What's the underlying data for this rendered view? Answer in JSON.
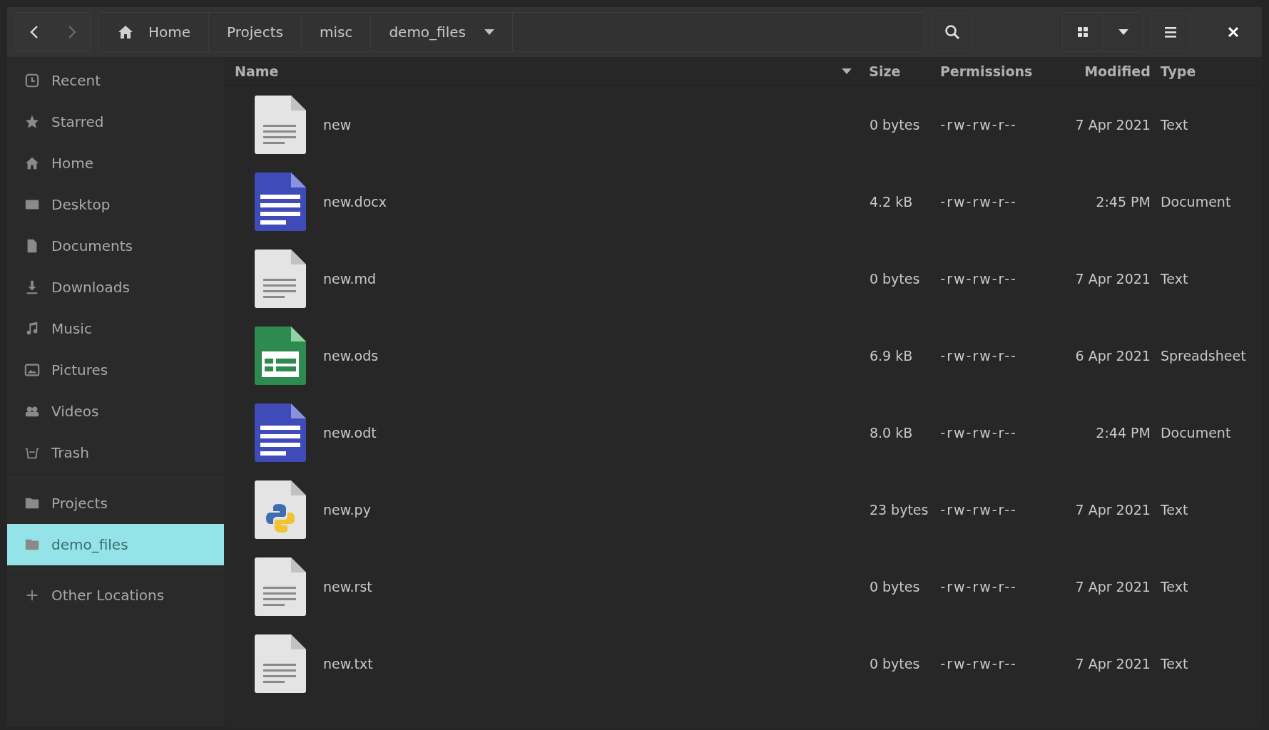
{
  "toolbar": {
    "nav": [
      {
        "kind": "back",
        "disabled": false
      },
      {
        "kind": "forward",
        "disabled": true
      }
    ],
    "breadcrumbs": [
      {
        "label": "Home"
      },
      {
        "label": "Projects"
      },
      {
        "label": "misc"
      },
      {
        "label": "demo_files"
      }
    ]
  },
  "sidebar": {
    "items": [
      {
        "label": "Recent",
        "kind": "recent",
        "selected": false
      },
      {
        "label": "Starred",
        "kind": "star",
        "selected": false
      },
      {
        "label": "Home",
        "kind": "home",
        "selected": false
      },
      {
        "label": "Desktop",
        "kind": "desktop",
        "selected": false
      },
      {
        "label": "Documents",
        "kind": "document",
        "selected": false
      },
      {
        "label": "Downloads",
        "kind": "download",
        "selected": false
      },
      {
        "label": "Music",
        "kind": "music",
        "selected": false
      },
      {
        "label": "Pictures",
        "kind": "pictures",
        "selected": false
      },
      {
        "label": "Videos",
        "kind": "videos",
        "selected": false
      },
      {
        "label": "Trash",
        "kind": "trash",
        "selected": false
      }
    ],
    "bookmarks": [
      {
        "label": "Projects",
        "kind": "folder",
        "selected": false
      },
      {
        "label": "demo_files",
        "kind": "folder",
        "selected": true
      }
    ],
    "other": {
      "label": "Other Locations",
      "kind": "plus"
    }
  },
  "table": {
    "columns": [
      {
        "label": "Name",
        "sorted": true
      },
      {
        "label": "Size",
        "sorted": false
      },
      {
        "label": "Permissions",
        "sorted": false
      },
      {
        "label": "Modified",
        "sorted": false
      },
      {
        "label": "Type",
        "sorted": false
      }
    ],
    "rows": [
      {
        "kind": "text",
        "name": "new",
        "size": "0 bytes",
        "permissions": "-rw-rw-r--",
        "modified": "7 Apr 2021",
        "type": "Text"
      },
      {
        "kind": "document",
        "name": "new.docx",
        "size": "4.2 kB",
        "permissions": "-rw-rw-r--",
        "modified": "2:45 PM",
        "type": "Document"
      },
      {
        "kind": "text",
        "name": "new.md",
        "size": "0 bytes",
        "permissions": "-rw-rw-r--",
        "modified": "7 Apr 2021",
        "type": "Text"
      },
      {
        "kind": "spreadsheet",
        "name": "new.ods",
        "size": "6.9 kB",
        "permissions": "-rw-rw-r--",
        "modified": "6 Apr 2021",
        "type": "Spreadsheet"
      },
      {
        "kind": "document",
        "name": "new.odt",
        "size": "8.0 kB",
        "permissions": "-rw-rw-r--",
        "modified": "2:44 PM",
        "type": "Document"
      },
      {
        "kind": "python",
        "name": "new.py",
        "size": "23 bytes",
        "permissions": "-rw-rw-r--",
        "modified": "7 Apr 2021",
        "type": "Text"
      },
      {
        "kind": "text",
        "name": "new.rst",
        "size": "0 bytes",
        "permissions": "-rw-rw-r--",
        "modified": "7 Apr 2021",
        "type": "Text"
      },
      {
        "kind": "text",
        "name": "new.txt",
        "size": "0 bytes",
        "permissions": "-rw-rw-r--",
        "modified": "7 Apr 2021",
        "type": "Text"
      }
    ]
  }
}
